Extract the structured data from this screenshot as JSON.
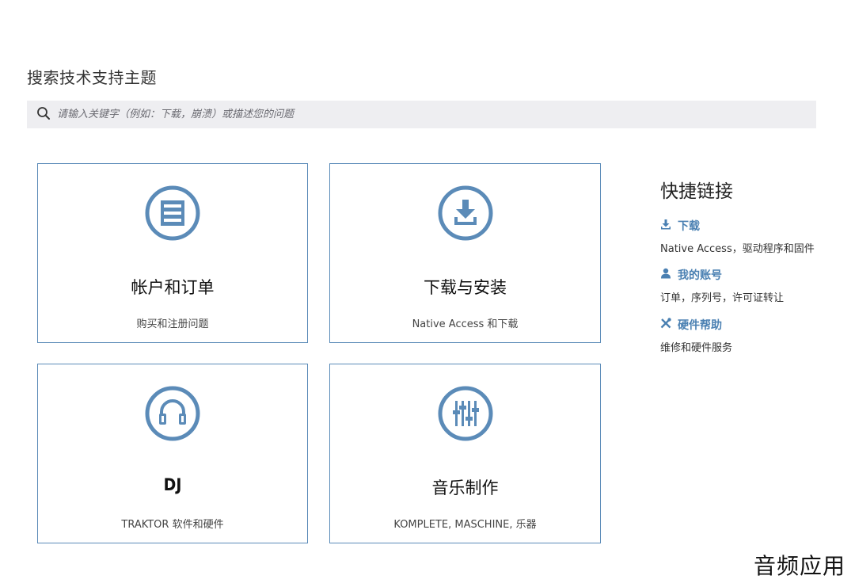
{
  "search": {
    "heading": "搜索技术支持主题",
    "placeholder": "请输入关键字（例如：下载，崩溃）或描述您的问题",
    "icon": "search-icon"
  },
  "cards": [
    {
      "title": "帐户和订单",
      "subtitle": "购买和注册问题",
      "icon": "list-icon"
    },
    {
      "title": "下载与安装",
      "subtitle": "Native Access 和下载",
      "icon": "download-icon"
    },
    {
      "title": "DJ",
      "subtitle": "TRAKTOR 软件和硬件",
      "icon": "headphones-icon"
    },
    {
      "title": "音乐制作",
      "subtitle": "KOMPLETE, MASCHINE, 乐器",
      "icon": "mixer-icon"
    }
  ],
  "quick_links": {
    "title": "快捷链接",
    "items": [
      {
        "label": "下载",
        "description": "Native Access，驱动程序和固件",
        "icon": "download-icon"
      },
      {
        "label": "我的账号",
        "description": "订单，序列号，许可证转让",
        "icon": "user-icon"
      },
      {
        "label": "硬件帮助",
        "description": "维修和硬件服务",
        "icon": "tools-icon"
      }
    ]
  },
  "watermark": "音频应用",
  "colors": {
    "accent": "#5b8bb8",
    "link": "#4a80b2",
    "search_bg": "#eeeef1"
  }
}
